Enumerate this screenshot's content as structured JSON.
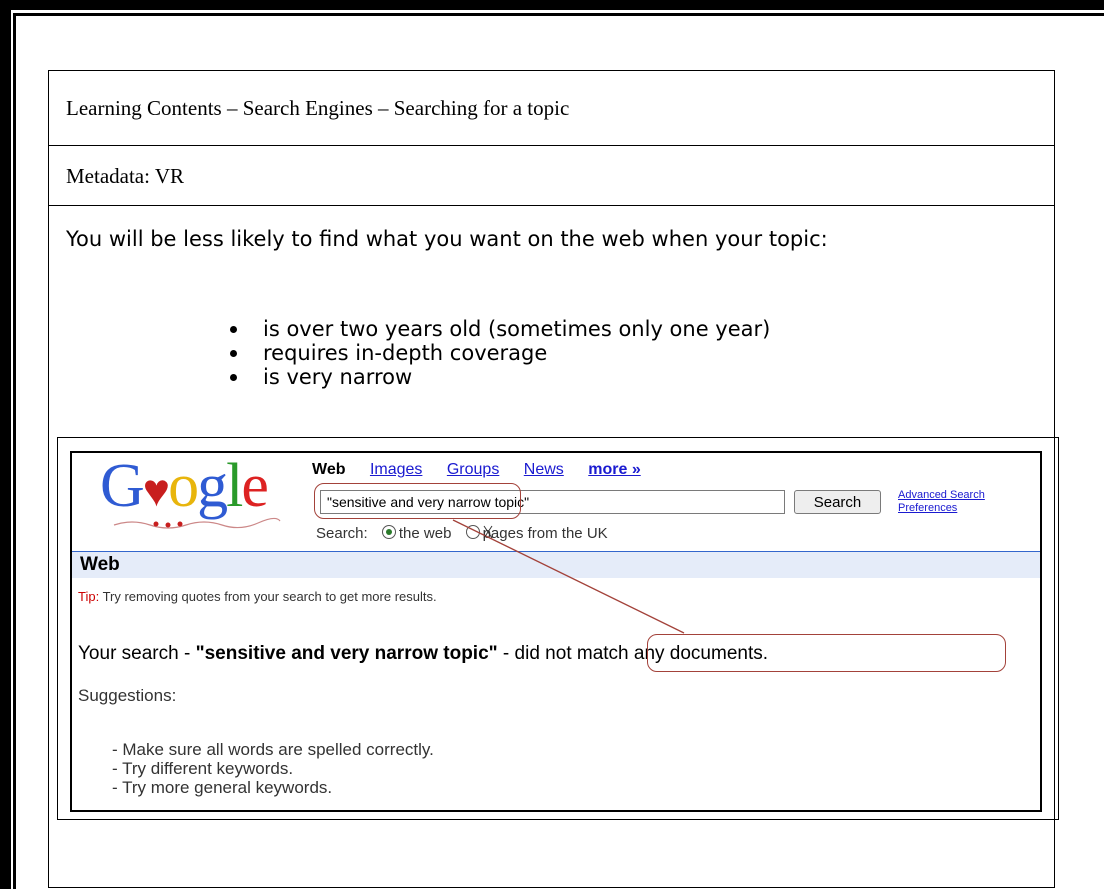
{
  "doc": {
    "title": "Learning Contents – Search Engines – Searching for a topic",
    "metadata": "Metadata: VR",
    "intro": "You will be less likely to find what you want on the web when your topic:",
    "bullets": [
      "is over two years old (sometimes only one year)",
      "requires in-depth coverage",
      "is very narrow"
    ]
  },
  "google": {
    "logo": "Google",
    "nav": {
      "web": "Web",
      "images": "Images",
      "groups": "Groups",
      "news": "News",
      "more": "more »"
    },
    "search_value": "\"sensitive and very narrow topic\"",
    "search_button": "Search",
    "advanced_search": "Advanced Search",
    "preferences": "Preferences",
    "scope_label": "Search:",
    "scope_web": "the web",
    "scope_uk": "pages from the UK",
    "section_header": "Web",
    "tip_label": "Tip:",
    "tip_text": " Try removing quotes from your search to get more results.",
    "result_prefix": "Your search - ",
    "result_query": "\"sensitive and very narrow topic\"",
    "result_dash": " - ",
    "result_suffix": "did not match any documents.",
    "suggestions_label": "Suggestions:",
    "suggestions": [
      "- Make sure all words are spelled correctly.",
      "- Try different keywords.",
      "- Try more general keywords."
    ]
  },
  "colors": {
    "highlight": "#a3423a",
    "link": "#1a1ad0",
    "web_bar": "#e5ecf9"
  }
}
